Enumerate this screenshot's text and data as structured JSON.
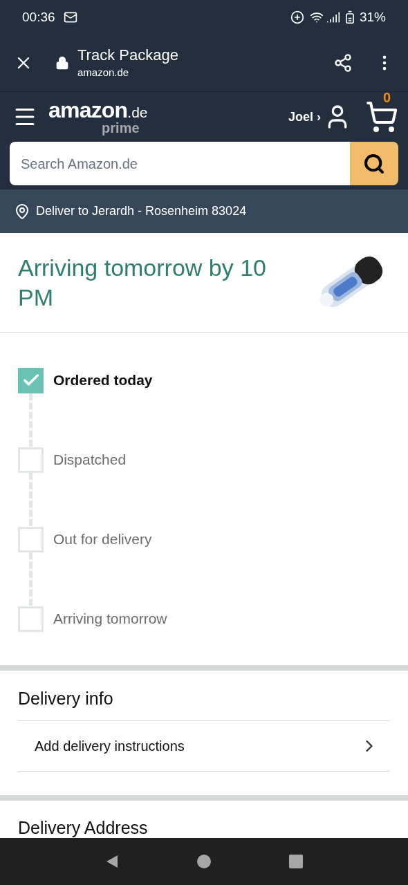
{
  "status_bar": {
    "time": "00:36",
    "battery": "31%"
  },
  "browser_bar": {
    "title": "Track Package",
    "url": "amazon.de"
  },
  "header": {
    "logo": "amazon",
    "logo_suffix": ".de",
    "logo_sub": "prime",
    "account": "Joel ›",
    "cart_count": "0"
  },
  "search": {
    "placeholder": "Search Amazon.de"
  },
  "deliver_to": "Deliver to Jerardh - Rosenheim 83024",
  "arrival": {
    "title": "Arriving tomorrow by 10 PM"
  },
  "steps": [
    {
      "label": "Ordered today",
      "checked": true
    },
    {
      "label": "Dispatched",
      "checked": false
    },
    {
      "label": "Out for delivery",
      "checked": false
    },
    {
      "label": "Arriving tomorrow",
      "checked": false
    }
  ],
  "delivery_info": {
    "title": "Delivery info",
    "items": [
      "Add delivery instructions"
    ]
  },
  "delivery_address": {
    "title": "Delivery Address"
  }
}
